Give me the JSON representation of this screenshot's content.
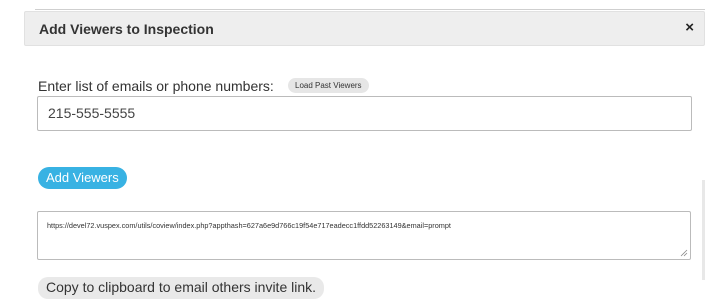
{
  "modal": {
    "title": "Add Viewers to Inspection",
    "close_glyph": "×"
  },
  "form": {
    "emails_label": "Enter list of emails or phone numbers:",
    "load_past_viewers_label": "Load Past Viewers",
    "emails_value": "215-555-5555",
    "add_viewers_label": "Add Viewers",
    "invite_link": "https://devel72.vuspex.com/utils/coview/index.php?appthash=627a6e9d766c19f54e717eadecc1ffdd52263149&email=prompt",
    "copy_label": "Copy to clipboard to email others invite link."
  },
  "colors": {
    "accent": "#38b2e3",
    "header_bg": "#eeeeee"
  }
}
